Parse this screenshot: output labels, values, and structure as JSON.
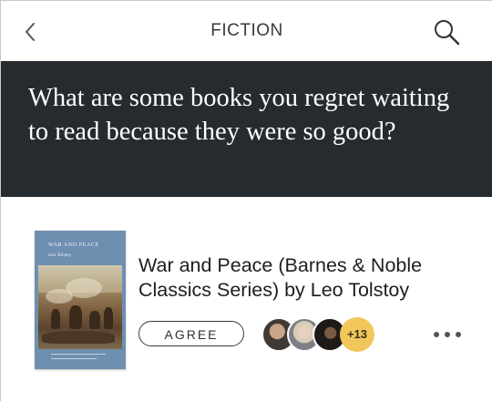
{
  "header": {
    "back_icon": "chevron-left-icon",
    "title": "FICTION",
    "search_icon": "search-icon"
  },
  "question": {
    "text": "What are some books you regret waiting to read because they were so good?"
  },
  "answer": {
    "cover": {
      "title": "WAR AND PEACE",
      "author": "Leo Tolstoy"
    },
    "book_title": "War and Peace (Barnes & Noble Classics Series) by Leo Tolstoy",
    "agree_label": "AGREE",
    "agree_count_label": "+13",
    "more_icon": "more-horizontal-icon"
  },
  "colors": {
    "question_bg": "#262b30",
    "badge": "#f1c75b",
    "cover_blue": "#6f8fb1"
  }
}
